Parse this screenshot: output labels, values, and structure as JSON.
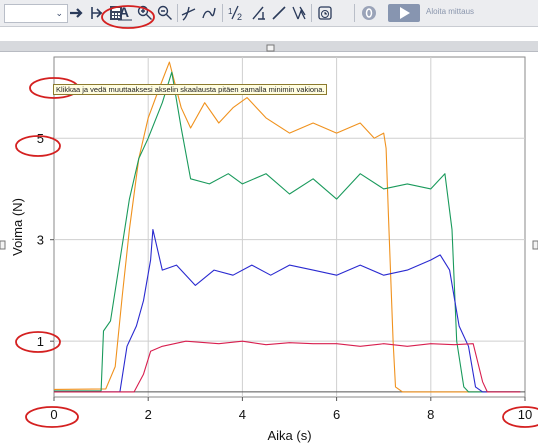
{
  "toolbar": {
    "run_button_label": "Aloita mittaus",
    "buttons": [
      "chevron-down-icon",
      "arrow-right-icon",
      "datamatrix-icon",
      "calculator-icon",
      "autoscale-icon",
      "zoom-in-icon",
      "zoom-out-icon",
      "tangent-icon",
      "curve-fit-icon",
      "integral-icon",
      "slope-icon",
      "linear-fit-icon",
      "model-icon",
      "stopwatch-icon",
      "zero-icon",
      "play-icon"
    ]
  },
  "tooltip": "Klikkaa ja vedä muuttaaksesi akselin skaalausta pitäen samalla minimin vakiona.",
  "chart_data": {
    "type": "line",
    "xlabel": "Aika (s)",
    "ylabel": "Voima (N)",
    "xlim": [
      0,
      10
    ],
    "ylim": [
      -0.1,
      6.6
    ],
    "x_ticks": [
      0,
      2,
      4,
      6,
      8,
      10
    ],
    "y_ticks": [
      1,
      3,
      5
    ],
    "grid": true,
    "series": [
      {
        "color": "#f0921e",
        "points": [
          [
            0,
            0.05
          ],
          [
            1.1,
            0.06
          ],
          [
            1.3,
            0.5
          ],
          [
            1.45,
            1.9
          ],
          [
            1.6,
            3.2
          ],
          [
            1.8,
            4.6
          ],
          [
            2.0,
            5.4
          ],
          [
            2.2,
            5.9
          ],
          [
            2.45,
            6.5
          ],
          [
            2.7,
            5.6
          ],
          [
            2.9,
            5.2
          ],
          [
            3.2,
            5.7
          ],
          [
            3.5,
            5.3
          ],
          [
            3.8,
            5.6
          ],
          [
            4.1,
            5.8
          ],
          [
            4.5,
            5.4
          ],
          [
            5.0,
            5.1
          ],
          [
            5.5,
            5.3
          ],
          [
            6.0,
            5.1
          ],
          [
            6.5,
            5.3
          ],
          [
            6.8,
            5.0
          ],
          [
            7.0,
            5.1
          ],
          [
            7.05,
            4.8
          ],
          [
            7.1,
            3.5
          ],
          [
            7.2,
            1.0
          ],
          [
            7.25,
            0.1
          ],
          [
            7.4,
            0.0
          ],
          [
            9.9,
            0.0
          ]
        ]
      },
      {
        "color": "#1a9a5c",
        "points": [
          [
            0,
            0.02
          ],
          [
            1.0,
            0.02
          ],
          [
            1.05,
            1.2
          ],
          [
            1.2,
            1.4
          ],
          [
            1.35,
            2.3
          ],
          [
            1.6,
            3.8
          ],
          [
            1.8,
            4.6
          ],
          [
            2.0,
            5.0
          ],
          [
            2.3,
            5.7
          ],
          [
            2.5,
            6.3
          ],
          [
            2.7,
            5.2
          ],
          [
            2.9,
            4.2
          ],
          [
            3.3,
            4.1
          ],
          [
            3.7,
            4.3
          ],
          [
            4.0,
            4.1
          ],
          [
            4.5,
            4.3
          ],
          [
            5.0,
            3.9
          ],
          [
            5.5,
            4.2
          ],
          [
            6.0,
            3.8
          ],
          [
            6.5,
            4.3
          ],
          [
            7.0,
            4.0
          ],
          [
            7.5,
            4.1
          ],
          [
            8.0,
            4.0
          ],
          [
            8.3,
            4.3
          ],
          [
            8.45,
            3.2
          ],
          [
            8.55,
            1.0
          ],
          [
            8.7,
            0.1
          ],
          [
            8.8,
            0.0
          ],
          [
            9.9,
            0.0
          ]
        ]
      },
      {
        "color": "#2a2ad0",
        "points": [
          [
            0,
            0.0
          ],
          [
            1.4,
            0.0
          ],
          [
            1.55,
            0.9
          ],
          [
            1.75,
            1.3
          ],
          [
            1.9,
            1.8
          ],
          [
            2.05,
            2.6
          ],
          [
            2.1,
            3.2
          ],
          [
            2.3,
            2.4
          ],
          [
            2.6,
            2.5
          ],
          [
            3.0,
            2.1
          ],
          [
            3.4,
            2.4
          ],
          [
            3.8,
            2.3
          ],
          [
            4.2,
            2.5
          ],
          [
            4.6,
            2.3
          ],
          [
            5.0,
            2.5
          ],
          [
            5.5,
            2.4
          ],
          [
            6.0,
            2.3
          ],
          [
            6.5,
            2.5
          ],
          [
            7.0,
            2.3
          ],
          [
            7.5,
            2.4
          ],
          [
            8.0,
            2.6
          ],
          [
            8.2,
            2.7
          ],
          [
            8.4,
            2.4
          ],
          [
            8.6,
            1.3
          ],
          [
            8.8,
            0.9
          ],
          [
            8.95,
            0.1
          ],
          [
            9.1,
            0.0
          ],
          [
            9.9,
            0.0
          ]
        ]
      },
      {
        "color": "#d81f4f",
        "points": [
          [
            0,
            0.0
          ],
          [
            1.7,
            0.0
          ],
          [
            1.9,
            0.35
          ],
          [
            2.05,
            0.8
          ],
          [
            2.3,
            0.9
          ],
          [
            2.8,
            1.0
          ],
          [
            3.5,
            0.95
          ],
          [
            4.0,
            1.0
          ],
          [
            4.5,
            0.93
          ],
          [
            5.0,
            0.97
          ],
          [
            5.5,
            0.95
          ],
          [
            6.0,
            0.95
          ],
          [
            6.5,
            0.9
          ],
          [
            7.0,
            0.95
          ],
          [
            7.5,
            0.9
          ],
          [
            8.0,
            0.95
          ],
          [
            8.5,
            0.93
          ],
          [
            8.9,
            0.95
          ],
          [
            9.1,
            0.2
          ],
          [
            9.2,
            0.0
          ],
          [
            9.9,
            0.0
          ]
        ]
      }
    ]
  }
}
